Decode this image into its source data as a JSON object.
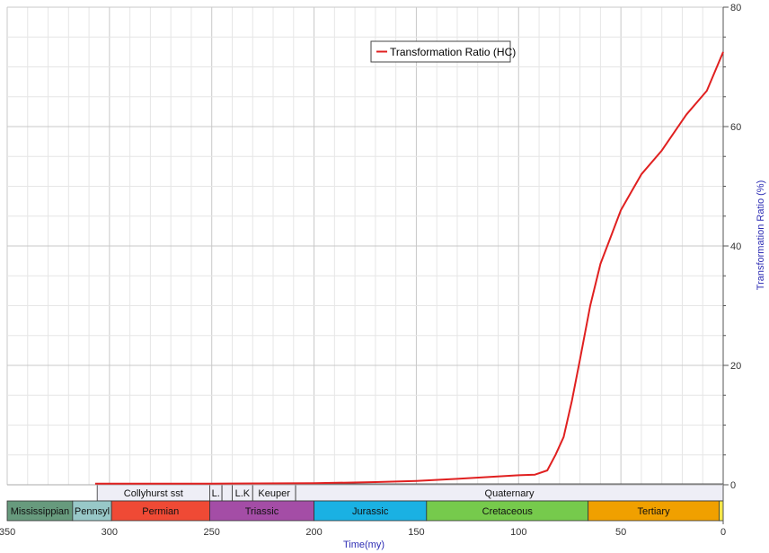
{
  "chart_data": {
    "type": "line",
    "title": "",
    "xlabel": "Time(my)",
    "ylabel": "Transformation Ratio (%)",
    "xlim": [
      350,
      0
    ],
    "ylim": [
      0,
      80
    ],
    "x_ticks": [
      350,
      300,
      250,
      200,
      150,
      100,
      50,
      0
    ],
    "y_ticks": [
      0,
      20,
      40,
      60,
      80
    ],
    "grid": true,
    "legend_position": "top-right",
    "series": [
      {
        "name": "Transformation Ratio (HC)",
        "color": "#e02020",
        "x": [
          307,
          250,
          200,
          170,
          150,
          130,
          100,
          92,
          86,
          82,
          78,
          74,
          70,
          65,
          60,
          55,
          50,
          45,
          40,
          30,
          18,
          8,
          0
        ],
        "y": [
          0.2,
          0.2,
          0.25,
          0.45,
          0.65,
          1.0,
          1.6,
          1.7,
          2.4,
          5.0,
          8.0,
          14.0,
          21.0,
          30.0,
          37.0,
          41.5,
          46.0,
          49.0,
          52.0,
          56.0,
          62.0,
          66.0,
          72.5
        ]
      }
    ],
    "stratigraphy": {
      "formations": [
        {
          "label": "Collyhurst sst",
          "from": 306,
          "to": 251
        },
        {
          "label": "L.",
          "from": 251,
          "to": 245
        },
        {
          "label": "",
          "from": 245,
          "to": 240
        },
        {
          "label": "L.K",
          "from": 240,
          "to": 230
        },
        {
          "label": "Keuper",
          "from": 230,
          "to": 209
        },
        {
          "label": "Quaternary",
          "from": 209,
          "to": 0
        }
      ],
      "periods": [
        {
          "label": "Mississippian",
          "from": 350,
          "to": 318,
          "color": "#679a7d"
        },
        {
          "label": "Pennsyl",
          "from": 318,
          "to": 299,
          "color": "#98c8c8"
        },
        {
          "label": "Permian",
          "from": 299,
          "to": 251,
          "color": "#ef4a35"
        },
        {
          "label": "Triassic",
          "from": 251,
          "to": 200,
          "color": "#a44da6"
        },
        {
          "label": "Jurassic",
          "from": 200,
          "to": 145,
          "color": "#1ab1e3"
        },
        {
          "label": "Cretaceous",
          "from": 145,
          "to": 66,
          "color": "#76ca4c"
        },
        {
          "label": "Tertiary",
          "from": 66,
          "to": 2,
          "color": "#f0a000"
        },
        {
          "label": "",
          "from": 2,
          "to": 0,
          "color": "#f5e84a"
        }
      ]
    }
  }
}
